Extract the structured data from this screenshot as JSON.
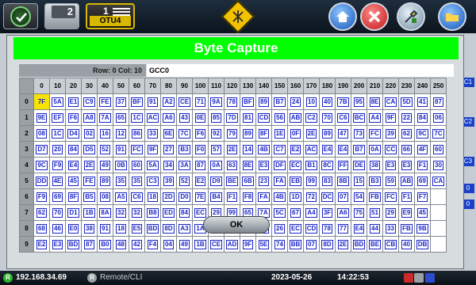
{
  "toolbar": {
    "counter_value": "2",
    "otu_number": "1",
    "otu_label": "OTU4"
  },
  "background": {
    "right_labels": [
      "C1",
      "C2",
      "C3",
      "0",
      "0"
    ]
  },
  "dialog": {
    "title": "Byte Capture",
    "position_label": "Row: 0  Col: 10",
    "channel": "GCC0",
    "ok_label": "OK",
    "selected": {
      "row": 0,
      "col": 0
    },
    "columns": [
      "0",
      "10",
      "20",
      "30",
      "40",
      "50",
      "60",
      "70",
      "80",
      "90",
      "100",
      "110",
      "120",
      "130",
      "140",
      "150",
      "160",
      "170",
      "180",
      "190",
      "200",
      "210",
      "220",
      "230",
      "240",
      "250"
    ],
    "rows": [
      {
        "label": "0",
        "cells": [
          "7F",
          "5A",
          "E1",
          "C9",
          "FE",
          "37",
          "BF",
          "91",
          "A2",
          "CE",
          "71",
          "9A",
          "78",
          "BF",
          "89",
          "B7",
          "24",
          "10",
          "40",
          "7B",
          "95",
          "8E",
          "CA",
          "5D",
          "41",
          "87"
        ]
      },
      {
        "label": "1",
        "cells": [
          "9E",
          "EF",
          "F6",
          "A8",
          "7A",
          "65",
          "1C",
          "AC",
          "A6",
          "43",
          "0E",
          "85",
          "7D",
          "81",
          "CD",
          "56",
          "AB",
          "C2",
          "70",
          "C6",
          "BC",
          "A4",
          "9F",
          "22",
          "84",
          "06"
        ]
      },
      {
        "label": "2",
        "cells": [
          "08",
          "1C",
          "D4",
          "02",
          "16",
          "12",
          "86",
          "33",
          "6E",
          "7C",
          "F6",
          "92",
          "79",
          "89",
          "8F",
          "1E",
          "0F",
          "2E",
          "89",
          "47",
          "73",
          "FC",
          "39",
          "62",
          "9C",
          "7C"
        ]
      },
      {
        "label": "3",
        "cells": [
          "D7",
          "20",
          "84",
          "D5",
          "52",
          "91",
          "FC",
          "9F",
          "27",
          "B3",
          "F0",
          "57",
          "2E",
          "14",
          "4B",
          "C7",
          "E2",
          "AC",
          "E4",
          "E4",
          "B7",
          "0A",
          "CC",
          "66",
          "4F",
          "60"
        ]
      },
      {
        "label": "4",
        "cells": [
          "9C",
          "F9",
          "E4",
          "2E",
          "49",
          "0B",
          "60",
          "5A",
          "34",
          "3A",
          "87",
          "0A",
          "63",
          "8E",
          "E3",
          "DF",
          "EC",
          "B1",
          "8C",
          "FF",
          "DE",
          "38",
          "E3",
          "E3",
          "F1",
          "30"
        ]
      },
      {
        "label": "5",
        "cells": [
          "DD",
          "4E",
          "45",
          "FE",
          "89",
          "35",
          "35",
          "C3",
          "39",
          "52",
          "E2",
          "D9",
          "BE",
          "6B",
          "23",
          "FA",
          "EB",
          "99",
          "83",
          "8B",
          "15",
          "B3",
          "59",
          "AB",
          "69",
          "CA"
        ]
      },
      {
        "label": "6",
        "cells": [
          "F9",
          "69",
          "8F",
          "B5",
          "08",
          "A5",
          "C6",
          "18",
          "2D",
          "D0",
          "7E",
          "B4",
          "F1",
          "F8",
          "FA",
          "4B",
          "1D",
          "72",
          "DC",
          "07",
          "54",
          "FB",
          "FC",
          "F1",
          "F7",
          ""
        ]
      },
      {
        "label": "7",
        "cells": [
          "62",
          "70",
          "D1",
          "1B",
          "8A",
          "32",
          "32",
          "B8",
          "ED",
          "84",
          "EC",
          "29",
          "99",
          "65",
          "7A",
          "5C",
          "67",
          "A4",
          "3F",
          "A6",
          "75",
          "51",
          "29",
          "E9",
          "45",
          ""
        ]
      },
      {
        "label": "8",
        "cells": [
          "68",
          "46",
          "E0",
          "38",
          "91",
          "18",
          "E5",
          "BD",
          "8D",
          "A3",
          "1A",
          "23",
          "F5",
          "76",
          "51",
          "26",
          "EC",
          "CD",
          "78",
          "77",
          "E4",
          "44",
          "33",
          "FB",
          "9B",
          ""
        ]
      },
      {
        "label": "9",
        "cells": [
          "E2",
          "E3",
          "BD",
          "87",
          "B0",
          "48",
          "42",
          "F4",
          "04",
          "49",
          "1B",
          "CE",
          "AD",
          "9F",
          "5E",
          "74",
          "BB",
          "07",
          "8D",
          "2E",
          "BD",
          "BE",
          "CB",
          "40",
          "DB",
          ""
        ]
      }
    ]
  },
  "status": {
    "ip": "192.168.34.69",
    "ip_icon": "R",
    "remote_icon": "R",
    "remote": "Remote/CLI",
    "date": "2023-05-26",
    "time": "14:22:53"
  },
  "colors": {
    "title_bar": "#00ff00",
    "cell_text": "#1a24c8",
    "selected_cell": "#f6e400",
    "otu_accent": "#d8b800"
  }
}
